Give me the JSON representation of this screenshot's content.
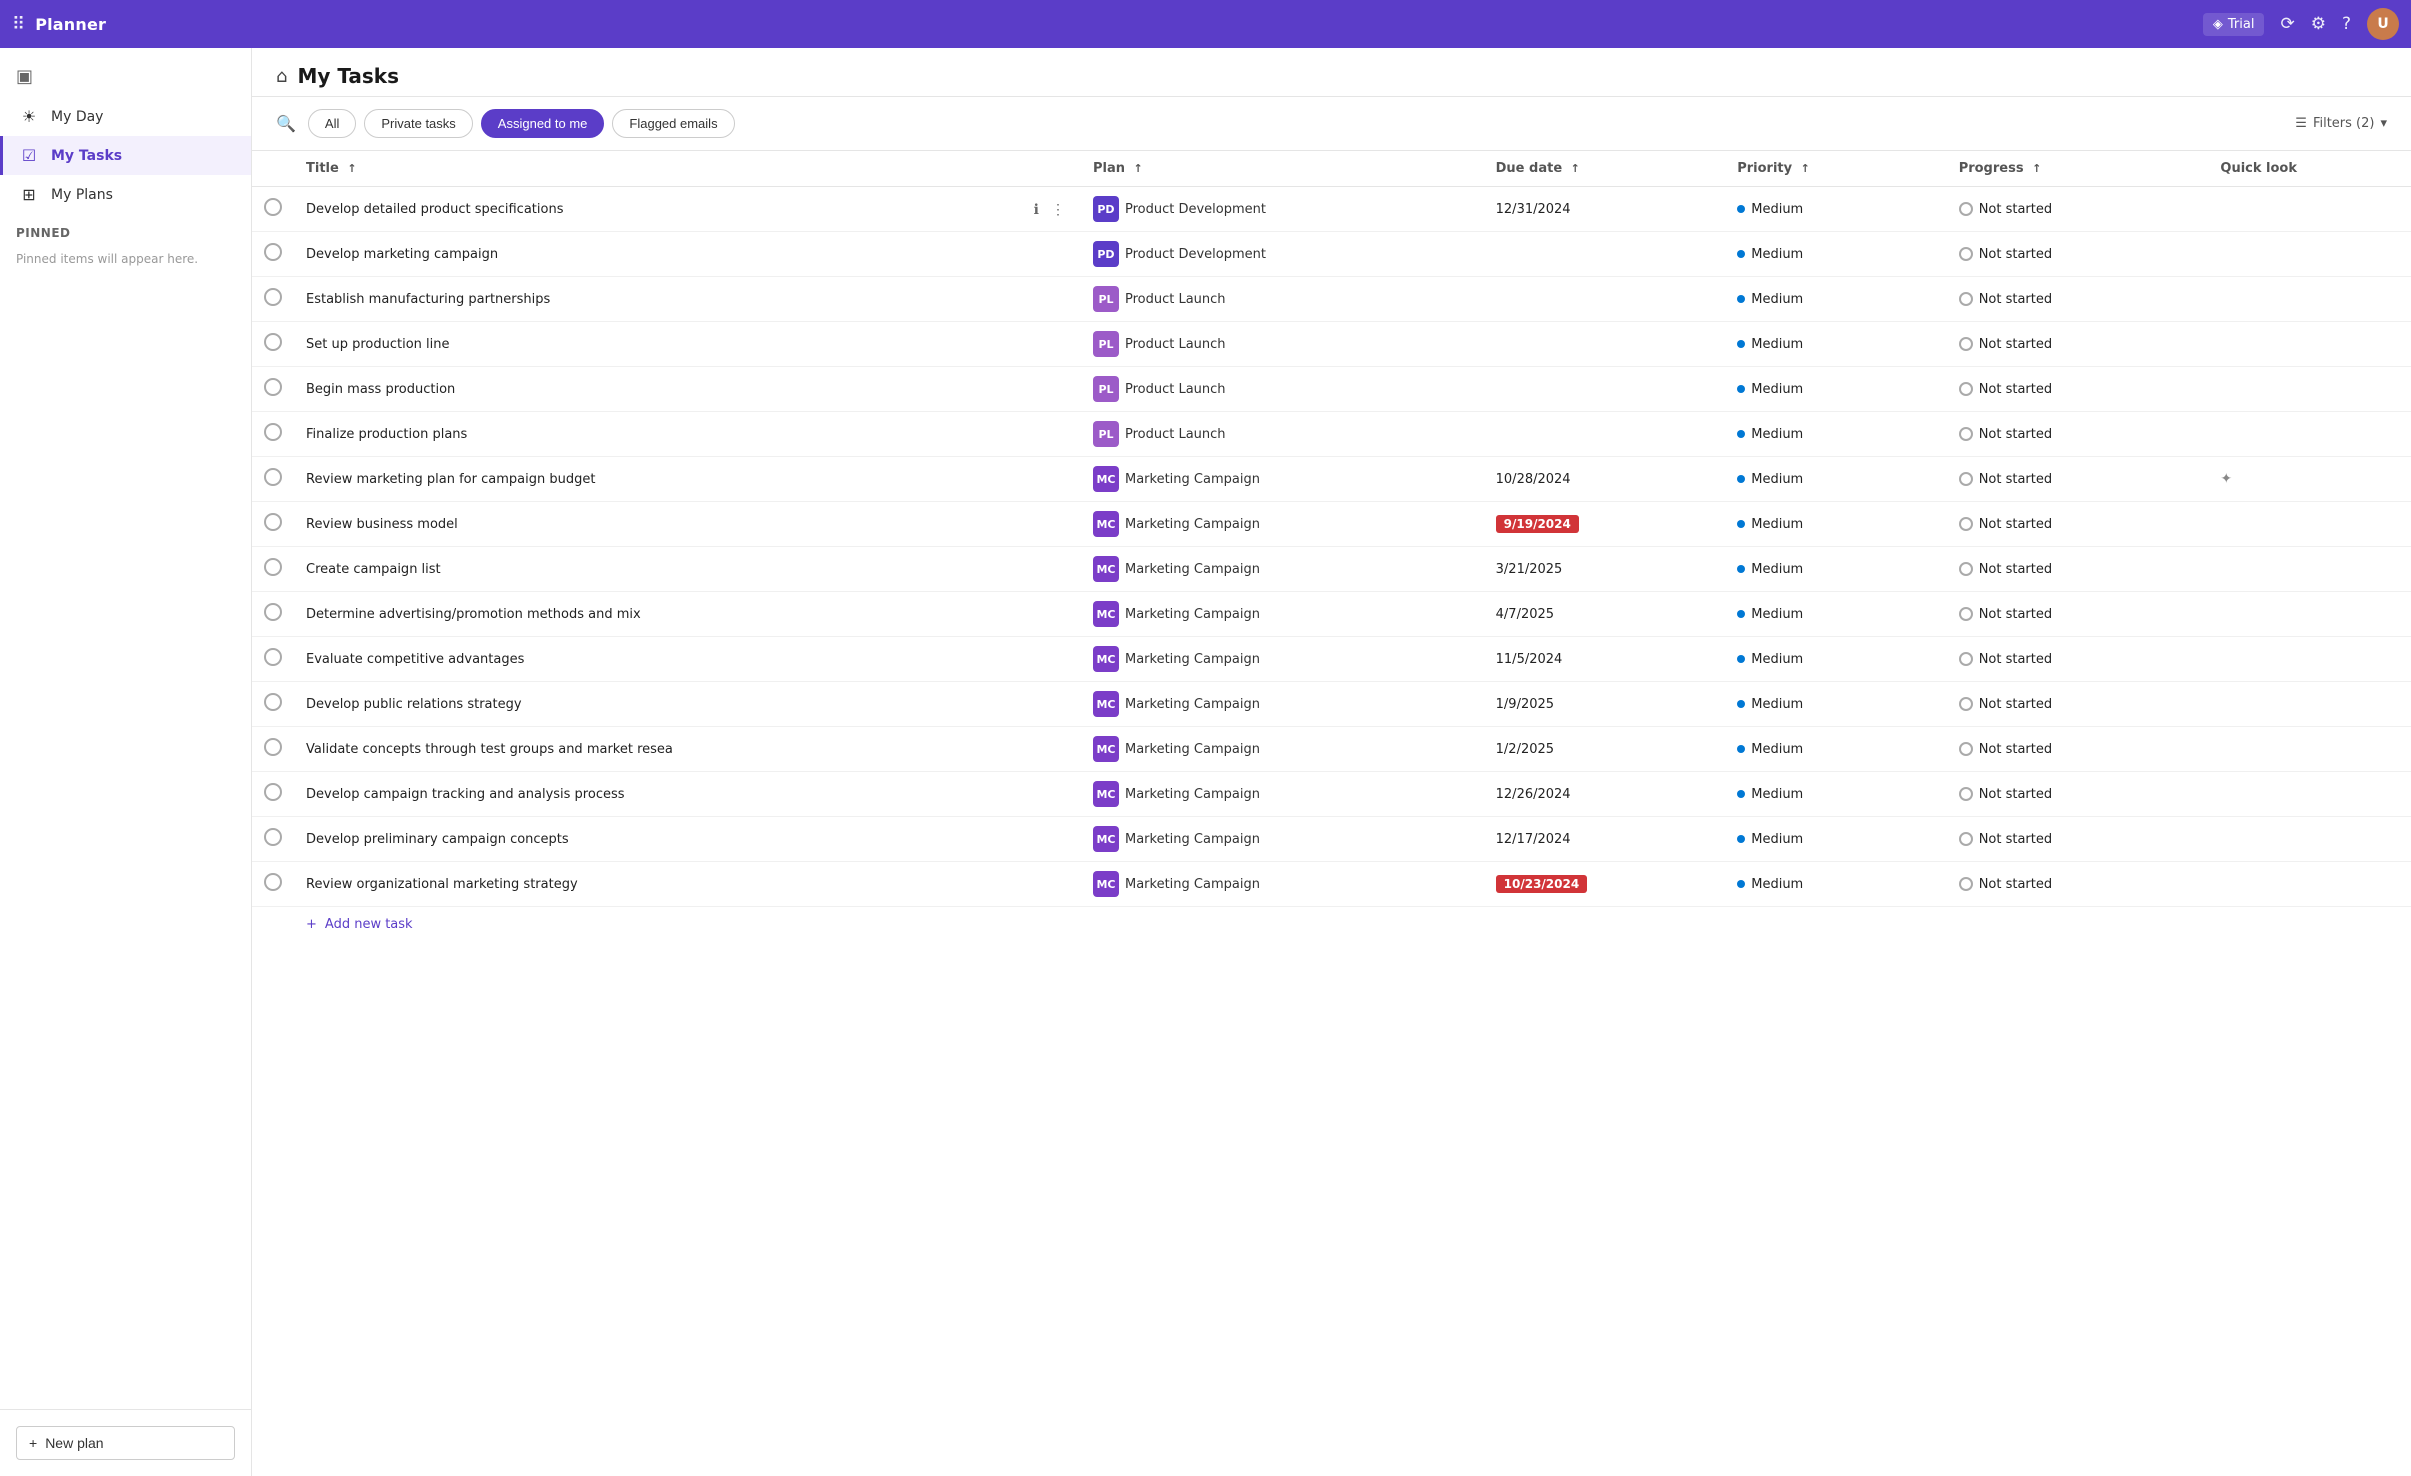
{
  "topbar": {
    "app_name": "Planner",
    "trial_label": "Trial",
    "dots_icon": "⠿",
    "share_icon": "⟳",
    "settings_icon": "⚙",
    "help_icon": "?",
    "avatar_initials": "U"
  },
  "sidebar": {
    "collapse_icon": "▣",
    "items": [
      {
        "id": "my-day",
        "label": "My Day",
        "icon": "☀",
        "active": false
      },
      {
        "id": "my-tasks",
        "label": "My Tasks",
        "icon": "☑",
        "active": true
      },
      {
        "id": "my-plans",
        "label": "My Plans",
        "icon": "⊞",
        "active": false
      }
    ],
    "pinned_header": "Pinned",
    "pinned_message": "Pinned items will appear here.",
    "new_plan_label": "New plan",
    "new_plan_icon": "+"
  },
  "page": {
    "icon": "⌂",
    "title": "My Tasks"
  },
  "filter_bar": {
    "search_icon": "🔍",
    "tabs": [
      {
        "id": "all",
        "label": "All",
        "active": false
      },
      {
        "id": "private-tasks",
        "label": "Private tasks",
        "active": false
      },
      {
        "id": "assigned-to-me",
        "label": "Assigned to me",
        "active": true
      },
      {
        "id": "flagged-emails",
        "label": "Flagged emails",
        "active": false
      }
    ],
    "filters_label": "Filters (2)",
    "filters_icon": "▼"
  },
  "table": {
    "columns": [
      {
        "id": "check",
        "label": ""
      },
      {
        "id": "title",
        "label": "Title",
        "sort": true
      },
      {
        "id": "plan",
        "label": "Plan",
        "sort": true
      },
      {
        "id": "due-date",
        "label": "Due date",
        "sort": true
      },
      {
        "id": "priority",
        "label": "Priority",
        "sort": true
      },
      {
        "id": "progress",
        "label": "Progress",
        "sort": true
      },
      {
        "id": "quick-look",
        "label": "Quick look"
      }
    ],
    "rows": [
      {
        "id": 1,
        "title": "Develop detailed product specifications",
        "plan_code": "PD",
        "plan_name": "Product Development",
        "plan_color": "#5b3dc8",
        "due_date": "12/31/2024",
        "due_overdue": false,
        "priority": "Medium",
        "progress": "Not started",
        "has_quicklook": false,
        "has_info": true
      },
      {
        "id": 2,
        "title": "Develop marketing campaign",
        "plan_code": "PD",
        "plan_name": "Product Development",
        "plan_color": "#5b3dc8",
        "due_date": "",
        "due_overdue": false,
        "priority": "Medium",
        "progress": "Not started",
        "has_quicklook": false,
        "has_info": false
      },
      {
        "id": 3,
        "title": "Establish manufacturing partnerships",
        "plan_code": "PL",
        "plan_name": "Product Launch",
        "plan_color": "#9c5bc8",
        "due_date": "",
        "due_overdue": false,
        "priority": "Medium",
        "progress": "Not started",
        "has_quicklook": false,
        "has_info": false
      },
      {
        "id": 4,
        "title": "Set up production line",
        "plan_code": "PL",
        "plan_name": "Product Launch",
        "plan_color": "#9c5bc8",
        "due_date": "",
        "due_overdue": false,
        "priority": "Medium",
        "progress": "Not started",
        "has_quicklook": false,
        "has_info": false
      },
      {
        "id": 5,
        "title": "Begin mass production",
        "plan_code": "PL",
        "plan_name": "Product Launch",
        "plan_color": "#9c5bc8",
        "due_date": "",
        "due_overdue": false,
        "priority": "Medium",
        "progress": "Not started",
        "has_quicklook": false,
        "has_info": false
      },
      {
        "id": 6,
        "title": "Finalize production plans",
        "plan_code": "PL",
        "plan_name": "Product Launch",
        "plan_color": "#9c5bc8",
        "due_date": "",
        "due_overdue": false,
        "priority": "Medium",
        "progress": "Not started",
        "has_quicklook": false,
        "has_info": false
      },
      {
        "id": 7,
        "title": "Review marketing plan for campaign budget",
        "plan_code": "MC",
        "plan_name": "Marketing Campaign",
        "plan_color": "#7b3dc8",
        "due_date": "10/28/2024",
        "due_overdue": false,
        "priority": "Medium",
        "progress": "Not started",
        "has_quicklook": true,
        "has_info": false
      },
      {
        "id": 8,
        "title": "Review business model",
        "plan_code": "MC",
        "plan_name": "Marketing Campaign",
        "plan_color": "#7b3dc8",
        "due_date": "9/19/2024",
        "due_overdue": true,
        "priority": "Medium",
        "progress": "Not started",
        "has_quicklook": false,
        "has_info": false
      },
      {
        "id": 9,
        "title": "Create campaign list",
        "plan_code": "MC",
        "plan_name": "Marketing Campaign",
        "plan_color": "#7b3dc8",
        "due_date": "3/21/2025",
        "due_overdue": false,
        "priority": "Medium",
        "progress": "Not started",
        "has_quicklook": false,
        "has_info": false
      },
      {
        "id": 10,
        "title": "Determine advertising/promotion methods and mix",
        "plan_code": "MC",
        "plan_name": "Marketing Campaign",
        "plan_color": "#7b3dc8",
        "due_date": "4/7/2025",
        "due_overdue": false,
        "priority": "Medium",
        "progress": "Not started",
        "has_quicklook": false,
        "has_info": false
      },
      {
        "id": 11,
        "title": "Evaluate competitive advantages",
        "plan_code": "MC",
        "plan_name": "Marketing Campaign",
        "plan_color": "#7b3dc8",
        "due_date": "11/5/2024",
        "due_overdue": false,
        "priority": "Medium",
        "progress": "Not started",
        "has_quicklook": false,
        "has_info": false
      },
      {
        "id": 12,
        "title": "Develop public relations strategy",
        "plan_code": "MC",
        "plan_name": "Marketing Campaign",
        "plan_color": "#7b3dc8",
        "due_date": "1/9/2025",
        "due_overdue": false,
        "priority": "Medium",
        "progress": "Not started",
        "has_quicklook": false,
        "has_info": false
      },
      {
        "id": 13,
        "title": "Validate concepts through test groups and market resea",
        "plan_code": "MC",
        "plan_name": "Marketing Campaign",
        "plan_color": "#7b3dc8",
        "due_date": "1/2/2025",
        "due_overdue": false,
        "priority": "Medium",
        "progress": "Not started",
        "has_quicklook": false,
        "has_info": false
      },
      {
        "id": 14,
        "title": "Develop campaign tracking and analysis process",
        "plan_code": "MC",
        "plan_name": "Marketing Campaign",
        "plan_color": "#7b3dc8",
        "due_date": "12/26/2024",
        "due_overdue": false,
        "priority": "Medium",
        "progress": "Not started",
        "has_quicklook": false,
        "has_info": false
      },
      {
        "id": 15,
        "title": "Develop preliminary campaign concepts",
        "plan_code": "MC",
        "plan_name": "Marketing Campaign",
        "plan_color": "#7b3dc8",
        "due_date": "12/17/2024",
        "due_overdue": false,
        "priority": "Medium",
        "progress": "Not started",
        "has_quicklook": false,
        "has_info": false
      },
      {
        "id": 16,
        "title": "Review organizational marketing strategy",
        "plan_code": "MC",
        "plan_name": "Marketing Campaign",
        "plan_color": "#7b3dc8",
        "due_date": "10/23/2024",
        "due_overdue": true,
        "priority": "Medium",
        "progress": "Not started",
        "has_quicklook": false,
        "has_info": false
      }
    ],
    "add_task_label": "Add new task"
  }
}
